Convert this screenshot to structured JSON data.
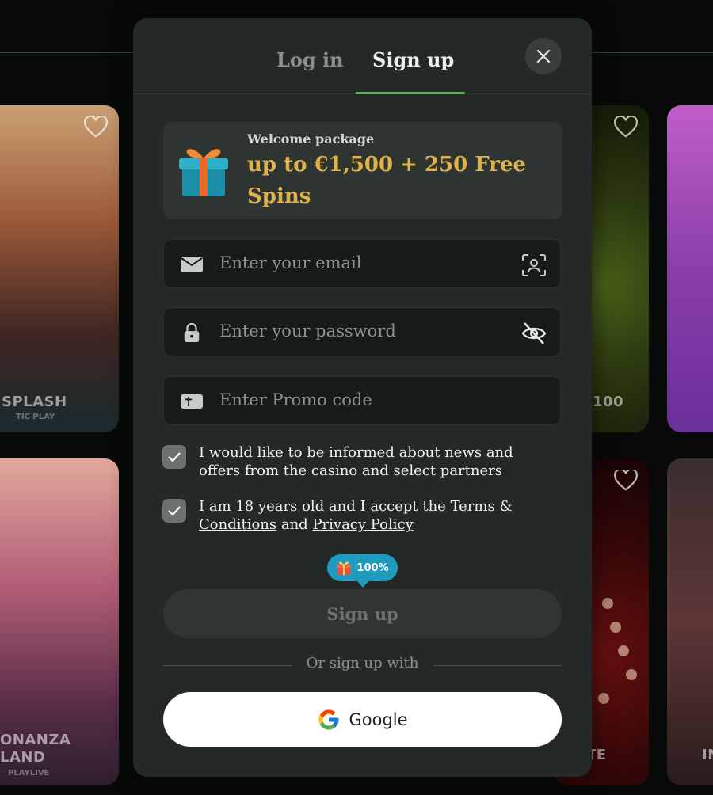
{
  "background": {
    "cards": [
      {
        "title": "SPLASH",
        "subtitle": "TIC PLAY"
      },
      {
        "title": "ONANZA LAND",
        "subtitle": "PLAYLIVE"
      },
      {
        "title": "100",
        "subtitle": ""
      },
      {
        "title": "TE",
        "subtitle": ""
      },
      {
        "title": "IN",
        "subtitle": ""
      }
    ]
  },
  "modal": {
    "tabs": [
      {
        "label": "Log in",
        "active": false
      },
      {
        "label": "Sign up",
        "active": true
      }
    ],
    "close_icon": "close-icon",
    "promo": {
      "label": "Welcome package",
      "value": "up to €1,500 + 250 Free Spins",
      "icon": "gift-icon"
    },
    "fields": {
      "email": {
        "placeholder": "Enter your email",
        "icon": "envelope-icon",
        "action_icon": "face-scan-icon"
      },
      "password": {
        "placeholder": "Enter your password",
        "icon": "lock-icon",
        "action_icon": "eye-off-icon"
      },
      "promo": {
        "placeholder": "Enter Promo code",
        "icon": "promo-ticket-icon"
      }
    },
    "checkboxes": {
      "news": {
        "checked": true,
        "text": "I would like to be informed about news and offers from the casino and select partners"
      },
      "terms": {
        "checked": true,
        "prefix": "I am 18 years old and I accept the ",
        "terms_link": "Terms & Conditions",
        "middle": " and ",
        "privacy_link": "Privacy Policy"
      }
    },
    "bonus_badge": {
      "value": "100%",
      "icon": "gift-icon"
    },
    "signup_button": "Sign up",
    "divider_text": "Or sign up with",
    "google_button": {
      "label": "Google",
      "icon": "google-icon"
    }
  },
  "colors": {
    "accent_green": "#64b35c",
    "promo_gold": "#e0b24a",
    "badge_blue": "#1e9bbd",
    "modal_bg": "#242927"
  }
}
